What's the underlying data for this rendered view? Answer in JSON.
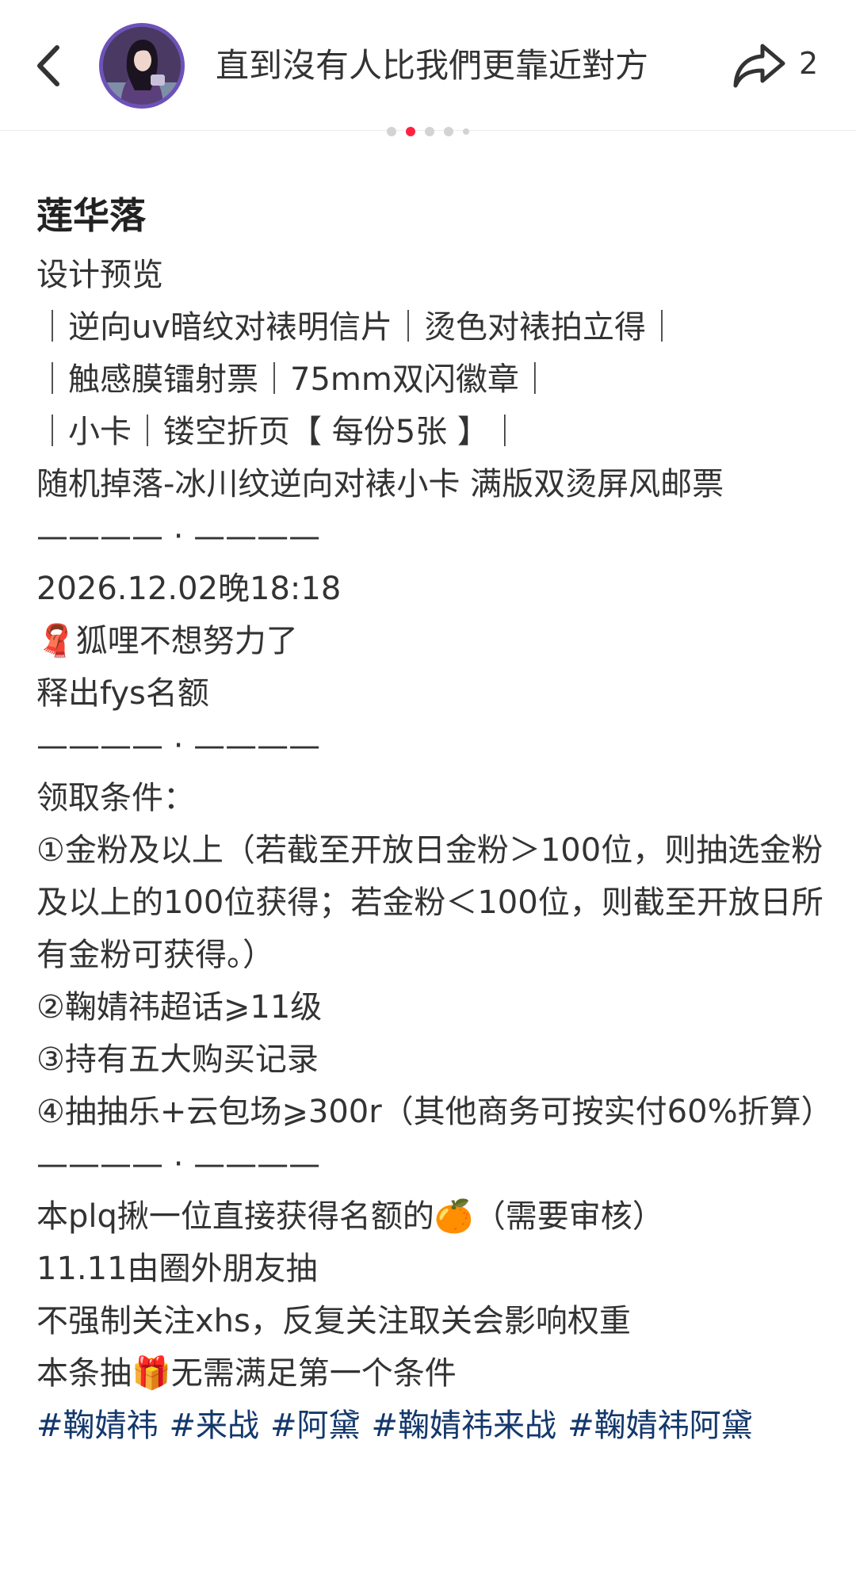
{
  "header": {
    "title": "直到沒有人比我們更靠近對方",
    "share_count": "2",
    "icons": [
      "back-arrow-icon",
      "avatar-image",
      "share-icon"
    ]
  },
  "carousel": {
    "total": 5,
    "active_index": 1
  },
  "post": {
    "title": "莲华落",
    "lines": [
      "设计预览",
      "｜逆向uv暗纹对裱明信片｜烫色对裱拍立得｜",
      "｜触感膜镭射票｜75mm双闪徽章｜",
      "｜小卡｜镂空折页【 每份5张 】｜",
      "随机掉落-冰川纹逆向对裱小卡 满版双烫屏风邮票",
      "———— · ————",
      "2026.12.02晚18:18",
      "🧣狐哩不想努力了",
      "释出fys名额",
      "———— · ————",
      "领取条件：",
      "①金粉及以上（若截至开放日金粉＞100位，则抽选金粉及以上的100位获得；若金粉＜100位，则截至开放日所有金粉可获得。）",
      "②鞠婧祎超话⩾11级",
      "③持有五大购买记录",
      "④抽抽乐+云包场⩾300r（其他商务可按实付60%折算）",
      "———— · ————",
      "本plq揪一位直接获得名额的🍊（需要审核）",
      "11.11由圈外朋友抽",
      "不强制关注xhs，反复关注取关会影响权重",
      "本条抽🎁无需满足第一个条件"
    ],
    "tags": [
      "#鞠婧祎",
      "#来战",
      "#阿黛",
      "#鞠婧祎来战",
      "#鞠婧祎阿黛"
    ]
  },
  "colors": {
    "tag": "#13386c",
    "avatar_ring": "#6d52b8",
    "dot_active": "#ff2442",
    "text": "#333333"
  }
}
